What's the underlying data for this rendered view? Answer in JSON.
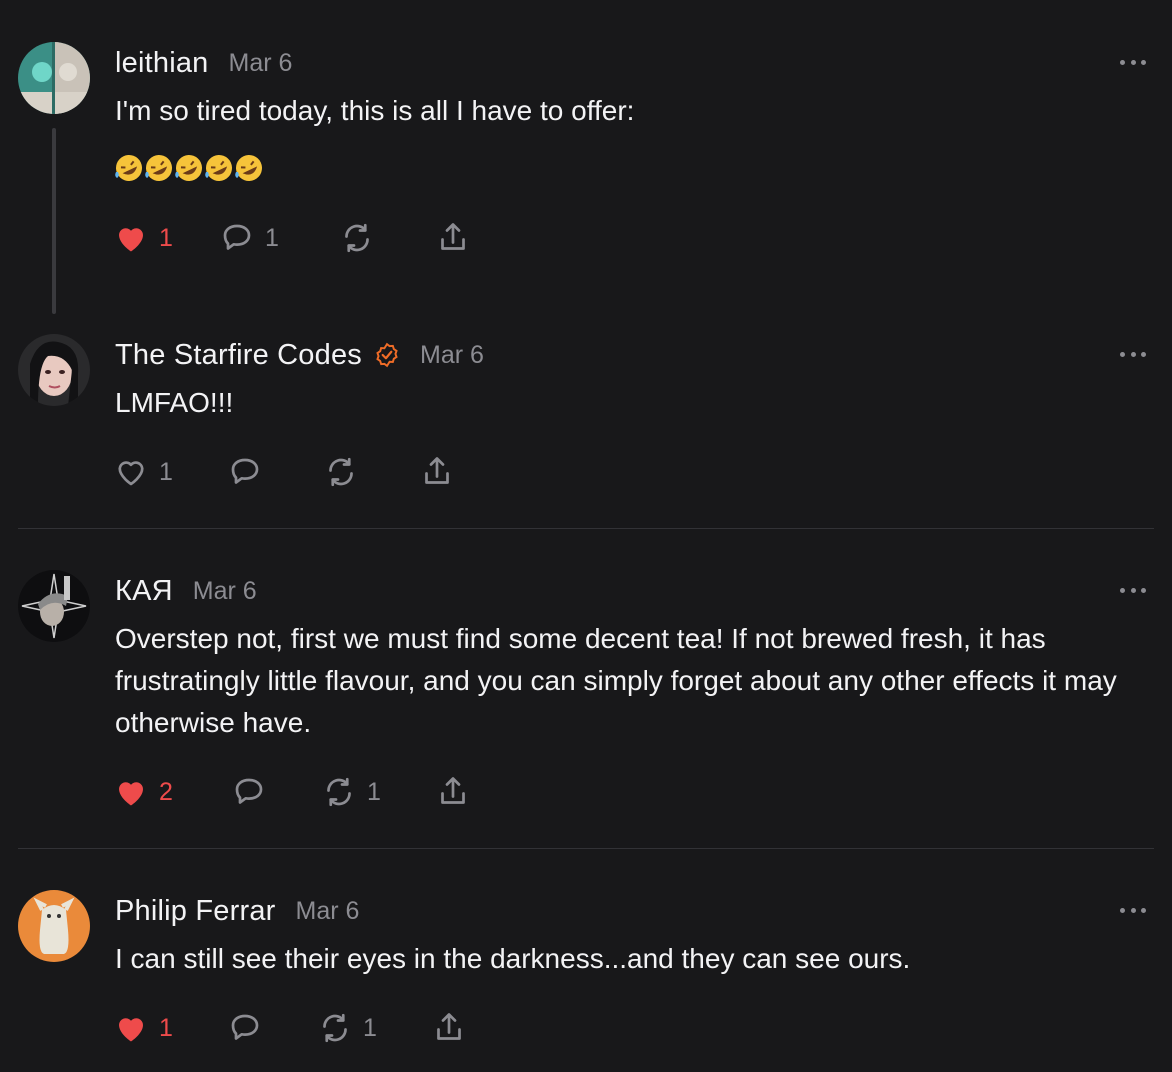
{
  "colors": {
    "background": "#18181a",
    "text": "#f3f3f5",
    "muted": "#8c8c92",
    "like": "#ee4b4b",
    "verified": "#ef6c27",
    "divider": "#323236"
  },
  "posts": [
    {
      "author": "leithian",
      "date": "Mar 6",
      "verified": false,
      "text": "I'm so tired today, this is all I have to offer:",
      "emoji": "🤣🤣🤣🤣🤣",
      "liked": true,
      "likes": "1",
      "replies": "1",
      "reposts": ""
    },
    {
      "author": "The Starfire Codes",
      "date": "Mar 6",
      "verified": true,
      "text": "LMFAO!!!",
      "liked": false,
      "likes": "1",
      "replies": "",
      "reposts": ""
    },
    {
      "author": "КАЯ",
      "date": "Mar 6",
      "verified": false,
      "text": "Overstep not, first we must find some decent tea! If not brewed fresh, it has frustratingly little flavour, and you can simply forget about any other effects it may otherwise have.",
      "liked": true,
      "likes": "2",
      "replies": "",
      "reposts": "1"
    },
    {
      "author": "Philip Ferrar",
      "date": "Mar 6",
      "verified": false,
      "text": "I can still see their eyes in the darkness...and they can see ours.",
      "liked": true,
      "likes": "1",
      "replies": "",
      "reposts": "1"
    }
  ]
}
